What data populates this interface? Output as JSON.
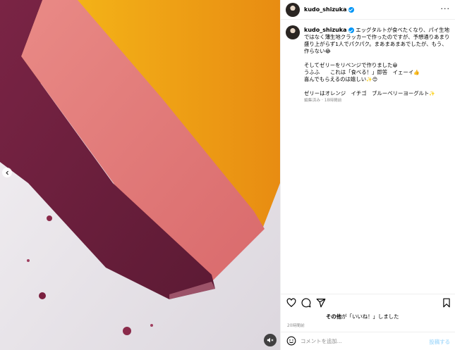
{
  "post": {
    "username": "kudo_shizuka",
    "more_icon": "more-horizontal-icon",
    "verified_icon": "verified-badge-icon"
  },
  "caption": {
    "lines": [
      "エッグタルトが食べたくなり、パイ生地ではなく薄生地クラッカーで作ったのですが、予想通りあまり盛り上がらず1人でパクパク。まあまあまあでしたが、もう、作らない",
      "そしてゼリーをリベンジで作りました",
      "うふふ　　これは「食べる！」即答　イェーイ",
      "喜んでもらえるのは嬉しい",
      "ゼリーはオレンジ　イチゴ　ブルーベリーヨーグルト"
    ],
    "meta": "編集済み · 18時間前"
  },
  "actions": {
    "like_icon": "heart-icon",
    "comment_icon": "comment-icon",
    "share_icon": "send-icon",
    "save_icon": "bookmark-icon"
  },
  "likes": {
    "bold": "その他",
    "rest": "が「いいね！」しました"
  },
  "timestamp": "20時間前",
  "comment": {
    "placeholder": "コメントを追加...",
    "post_label": "投稿する",
    "emoji_icon": "emoji-icon"
  },
  "photo": {
    "alt_colors": {
      "blueberry": "#6b1e3a",
      "strawberry": "#e87f7a",
      "orange": "#f0a020",
      "plate": "#ece8ec"
    }
  }
}
